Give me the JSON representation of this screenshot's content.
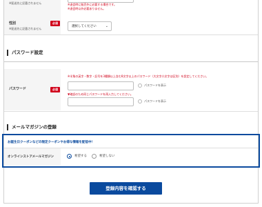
{
  "gender_row": {
    "top_note_1": "※理解が販売外に必要な場合は入力",
    "top_note_2": "※配送先に記載されません",
    "top_red_note_1": "※退会時に販売外に必要する場合です。",
    "top_red_note_2": "※退会時以外必要ありません。",
    "label": "性別",
    "required": "必須",
    "sub_note": "※配送先に記載されません",
    "select_value": "選択してください"
  },
  "password_section": {
    "title": "パスワード設定",
    "label": "パスワード",
    "required": "必須",
    "note_1": "※半角の英字・数字・記号を3種類以上含む8文字以上のパスワード（大文字小文字は区別）を設定してください。",
    "note_2": "▼確認のため同じパスワードを再入力してください。",
    "show_1": "パスワードを表示",
    "show_2": "パスワードを表示"
  },
  "newsletter_section": {
    "title": "メールマガジンの登録",
    "promo": "お誕生日クーポンなどの限定クーポンやお得な情報を配信中！",
    "label": "オンラインストアメールマガジン",
    "option_yes": "希望する",
    "option_no": "希望しない"
  },
  "submit": {
    "label": "登録内容を確認する"
  },
  "colors": {
    "accent": "#0a4a9e",
    "required_badge": "#d0021b"
  }
}
